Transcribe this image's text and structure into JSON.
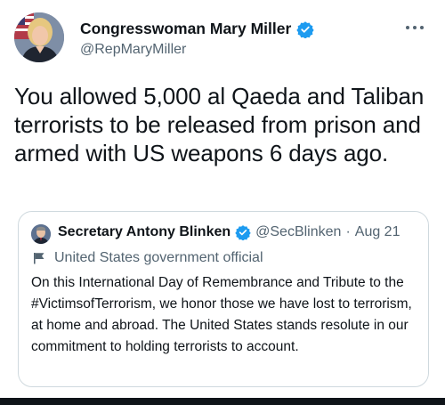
{
  "tweet": {
    "display_name": "Congresswoman Mary Miller",
    "handle": "@RepMaryMiller",
    "text": "You allowed 5,000 al Qaeda and Taliban terrorists to be released from prison and armed with US weapons 6 days ago.",
    "verified_icon": "verified-badge-icon",
    "more_icon": "more-options-icon"
  },
  "quoted_tweet": {
    "display_name": "Secretary Antony Blinken",
    "handle": "@SecBlinken",
    "separator": "·",
    "date": "Aug 21",
    "label": "United States government official",
    "label_icon": "flag-icon",
    "text": "On this International Day of Remembrance and Tribute to the #VictimsofTerrorism, we honor those we have lost to terrorism, at home and abroad. The United States stands resolute in our commitment to holding terrorists to account."
  },
  "colors": {
    "verified_blue": "#1d9bf0",
    "secondary_text": "#536471",
    "primary_text": "#0f1419",
    "border": "#cfd9de"
  }
}
